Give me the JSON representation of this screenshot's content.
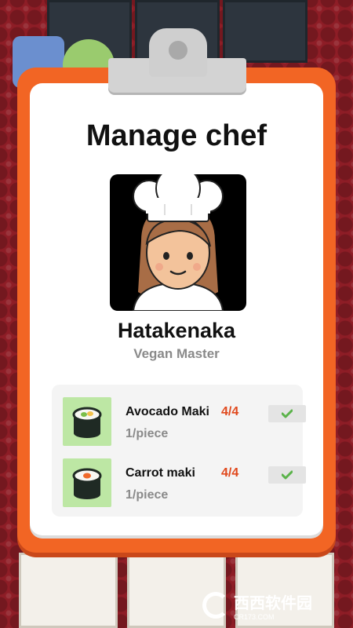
{
  "dialog": {
    "title": "Manage chef",
    "chef_name": "Hatakenaka",
    "chef_title": "Vegan Master"
  },
  "recipes": [
    {
      "name": "Avocado Maki",
      "count": "4/4",
      "price": "1/piece",
      "icon": "avocado-maki-icon",
      "checked": true
    },
    {
      "name": "Carrot maki",
      "count": "4/4",
      "price": "1/piece",
      "icon": "carrot-maki-icon",
      "checked": true
    }
  ],
  "watermark": {
    "brand": "西西软件园",
    "site": "CR173.COM"
  },
  "colors": {
    "board": "#f26524",
    "background": "#8e1d26",
    "count_text": "#e0481c",
    "check": "#5bb34a",
    "thumb_bg": "#bde7a4"
  }
}
